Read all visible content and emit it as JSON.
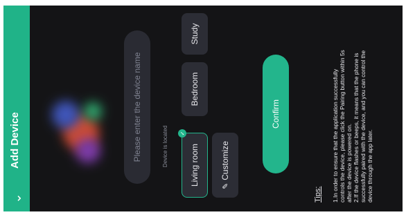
{
  "header": {
    "back_icon": "chevron-down-icon",
    "title": "Add Device",
    "bg_color": "#20b388"
  },
  "device_image": {
    "icon": "device-image-blurred"
  },
  "name_input": {
    "placeholder": "Please enter the device name",
    "value": ""
  },
  "location": {
    "label": "Device is located",
    "rooms": [
      {
        "label": "Living room",
        "selected": true
      },
      {
        "label": "Bedroom",
        "selected": false
      },
      {
        "label": "Study",
        "selected": false
      }
    ],
    "customize_label": "Customize",
    "customize_icon": "pencil-icon"
  },
  "confirm": {
    "label": "Confirm",
    "color": "#23b58c"
  },
  "tips": {
    "heading": "Tips:",
    "lines": [
      "1.In order to ensure that the application successfully",
      "controls the device, please click the Pairing button within 5s",
      "after the device is powered on.",
      "2.If the device flashes or beeps, it means that the phone is",
      "successfully paired with the device, and you can control the",
      "device through the app later."
    ]
  }
}
